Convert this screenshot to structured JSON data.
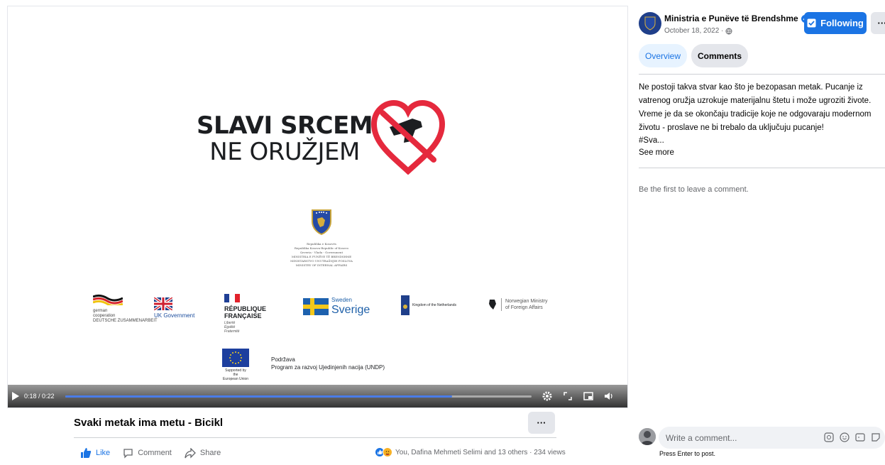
{
  "video": {
    "slogan_line1": "SLAVI SRCEM",
    "slogan_line2": "NE ORUŽJEM",
    "crest_text": [
      "Republika e Kosovës",
      "Republika Kosova-Republic of Kosovo",
      "Qeveria - Vlada - Government",
      "MINISTRIA E PUNËVE TË BRENDSHME",
      "MINISTARSTVO UNUTRAŠNJIH POSLOVA",
      "MINISTRY OF INTERNAL AFFAIRS"
    ],
    "partners": {
      "german": [
        "german",
        "cooperation",
        "DEUTSCHE ZUSAMMENARBEIT"
      ],
      "uk": "UK Government",
      "france": [
        "RÉPUBLIQUE",
        "FRANÇAISE"
      ],
      "france_motto": [
        "Liberté",
        "Égalité",
        "Fraternité"
      ],
      "sweden_small": "Sweden",
      "sweden_big": "Sverige",
      "netherlands": "Kingdom of the Netherlands",
      "norway": [
        "Norwegian Ministry",
        "of Foreign Affairs"
      ]
    },
    "eu_support": [
      "Supported by the",
      "European Union"
    ],
    "undp_text": [
      "Podržava",
      "Program za razvoj Ujedinjenih nacija (UNDP)"
    ],
    "time": "0:18 / 0:22",
    "progress": 0.83
  },
  "post": {
    "title": "Svaki metak ima metu - Bicikl",
    "more_label": "···",
    "actions": {
      "like": "Like",
      "comment": "Comment",
      "share": "Share"
    },
    "reactions_text": "You, Dafina Mehmeti Selimi and 13 others · 234 views"
  },
  "sidebar": {
    "page_name": "Ministria e Punëve të Brendshme",
    "date": "October 18, 2022 ·",
    "follow_label": "Following",
    "more_label": "···",
    "tabs": [
      {
        "label": "Overview"
      },
      {
        "label": "Comments"
      }
    ],
    "text": "Ne postoji takva stvar kao što je bezopasan metak. Pucanje iz vatrenog oružja uzrokuje materijalnu štetu i može ugroziti živote. Vreme je da se okončaju tradicije koje ne odgovaraju modernom životu - proslave ne bi trebalo da uključuju pucanje!",
    "hashtag": "#Sva...",
    "see_more": "See more",
    "empty_comments": "Be the first to leave a comment.",
    "comment_placeholder": "Write a comment...",
    "comment_hint": "Press Enter to post."
  },
  "colors": {
    "accent": "#1b74e4",
    "heart_red": "#e5293d",
    "kosovo_blue": "#244aa5"
  }
}
